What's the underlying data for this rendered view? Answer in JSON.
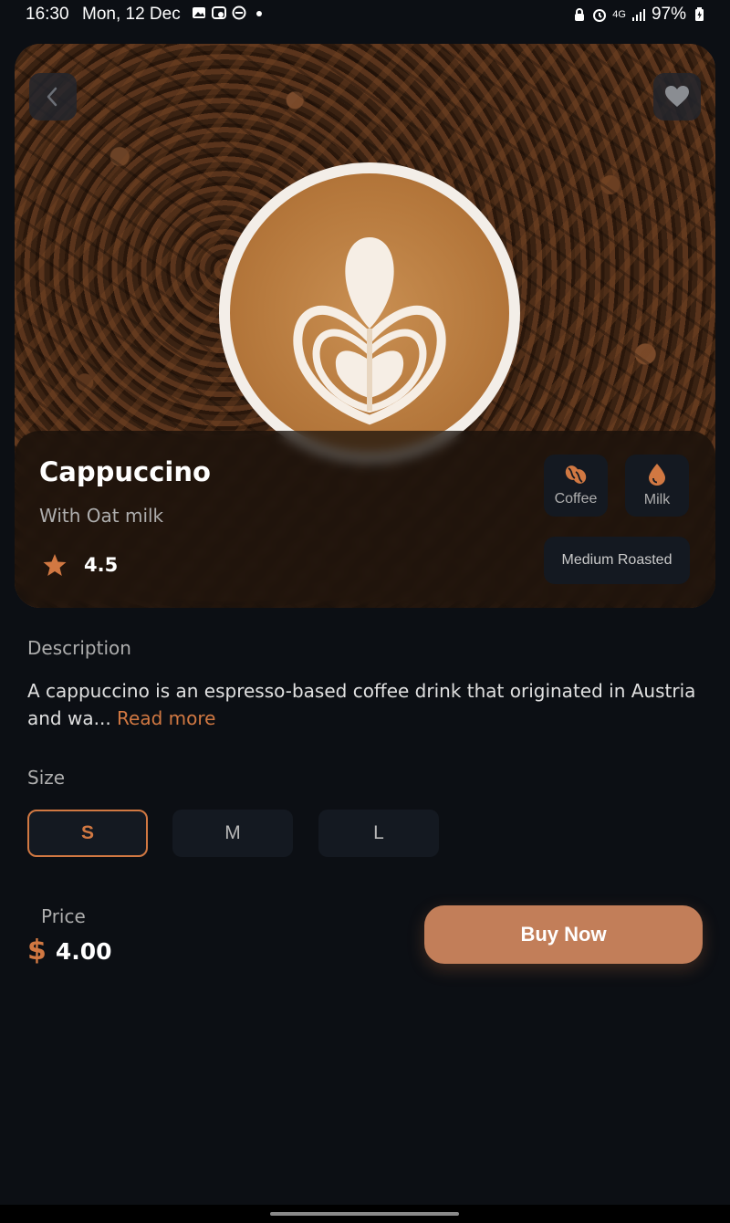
{
  "status_bar": {
    "time": "16:30",
    "date": "Mon, 12 Dec",
    "network": "4G",
    "battery": "97%",
    "left_icons": [
      "gallery-icon",
      "screen-record-icon",
      "dnd-icon",
      "dot-icon"
    ],
    "right_icons": [
      "lock-icon",
      "alarm-icon",
      "network-4g-icon",
      "signal-icon",
      "battery-icon"
    ]
  },
  "product": {
    "name": "Cappuccino",
    "subtitle": "With Oat milk",
    "rating": "4.5",
    "tags": [
      {
        "label": "Coffee",
        "icon": "coffee-bean-icon"
      },
      {
        "label": "Milk",
        "icon": "milk-drop-icon"
      }
    ],
    "roast": "Medium Roasted"
  },
  "description": {
    "label": "Description",
    "text": "A cappuccino is an espresso-based coffee drink that originated in Austria and wa...",
    "read_more": "Read more"
  },
  "size": {
    "label": "Size",
    "options": [
      "S",
      "M",
      "L"
    ],
    "selected": "S"
  },
  "price": {
    "label": "Price",
    "currency": "$",
    "value": "4.00"
  },
  "actions": {
    "buy_label": "Buy Now"
  },
  "colors": {
    "accent": "#d17842",
    "background": "#0c0f14",
    "surface": "#141921",
    "buy_button": "#c27e59"
  }
}
